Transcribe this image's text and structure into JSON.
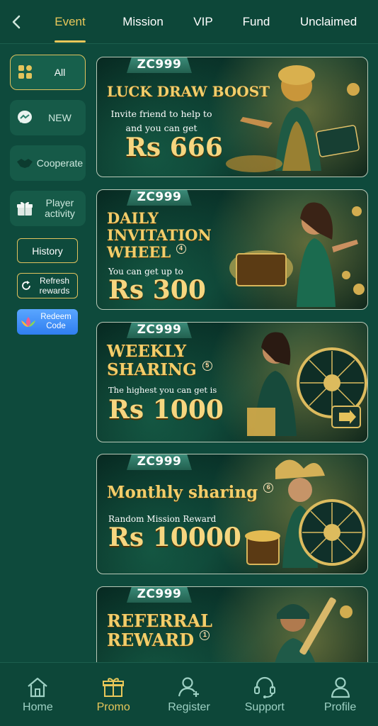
{
  "colors": {
    "accent": "#e8c75a",
    "background": "#0e4a3c",
    "nav_text": "#9ed1c4"
  },
  "header": {
    "back_icon": "chevron-left-icon",
    "tabs": [
      {
        "label": "Event",
        "active": true
      },
      {
        "label": "Mission"
      },
      {
        "label": "VIP"
      },
      {
        "label": "Fund"
      },
      {
        "label": "Unclaimed"
      }
    ]
  },
  "sidebar": {
    "categories": [
      {
        "label": "All",
        "icon": "grid-icon",
        "active": true
      },
      {
        "label": "NEW",
        "icon": "messenger-icon"
      },
      {
        "label": "Cooperate",
        "icon": "handshake-icon"
      },
      {
        "label": "Player activity",
        "icon": "gift-icon"
      }
    ],
    "history_label": "History",
    "refresh_label": "Refresh rewards",
    "redeem_label": "Redeem Code"
  },
  "banners": [
    {
      "logo": "ZC999",
      "title": "LUCK DRAW BOOST",
      "subtitle": "Invite friend to help to and you can get",
      "amount": "Rs 666"
    },
    {
      "logo": "ZC999",
      "title": "DAILY INVITATION WHEEL",
      "badge": "4",
      "subtitle": "You can get up to",
      "amount": "Rs 300"
    },
    {
      "logo": "ZC999",
      "title": "WEEKLY SHARING",
      "badge": "5",
      "subtitle": "The highest you can get is",
      "amount": "Rs 1000"
    },
    {
      "logo": "ZC999",
      "title": "Monthly sharing",
      "badge": "6",
      "subtitle": "Random Mission Reward",
      "amount": "Rs 10000"
    },
    {
      "logo": "ZC999",
      "title": "REFERRAL REWARD",
      "badge": "1"
    }
  ],
  "bottom_nav": [
    {
      "label": "Home",
      "icon": "home-icon"
    },
    {
      "label": "Promo",
      "icon": "gift-icon",
      "active": true
    },
    {
      "label": "Register",
      "icon": "add-user-icon"
    },
    {
      "label": "Support",
      "icon": "headset-icon"
    },
    {
      "label": "Profile",
      "icon": "user-icon"
    }
  ]
}
